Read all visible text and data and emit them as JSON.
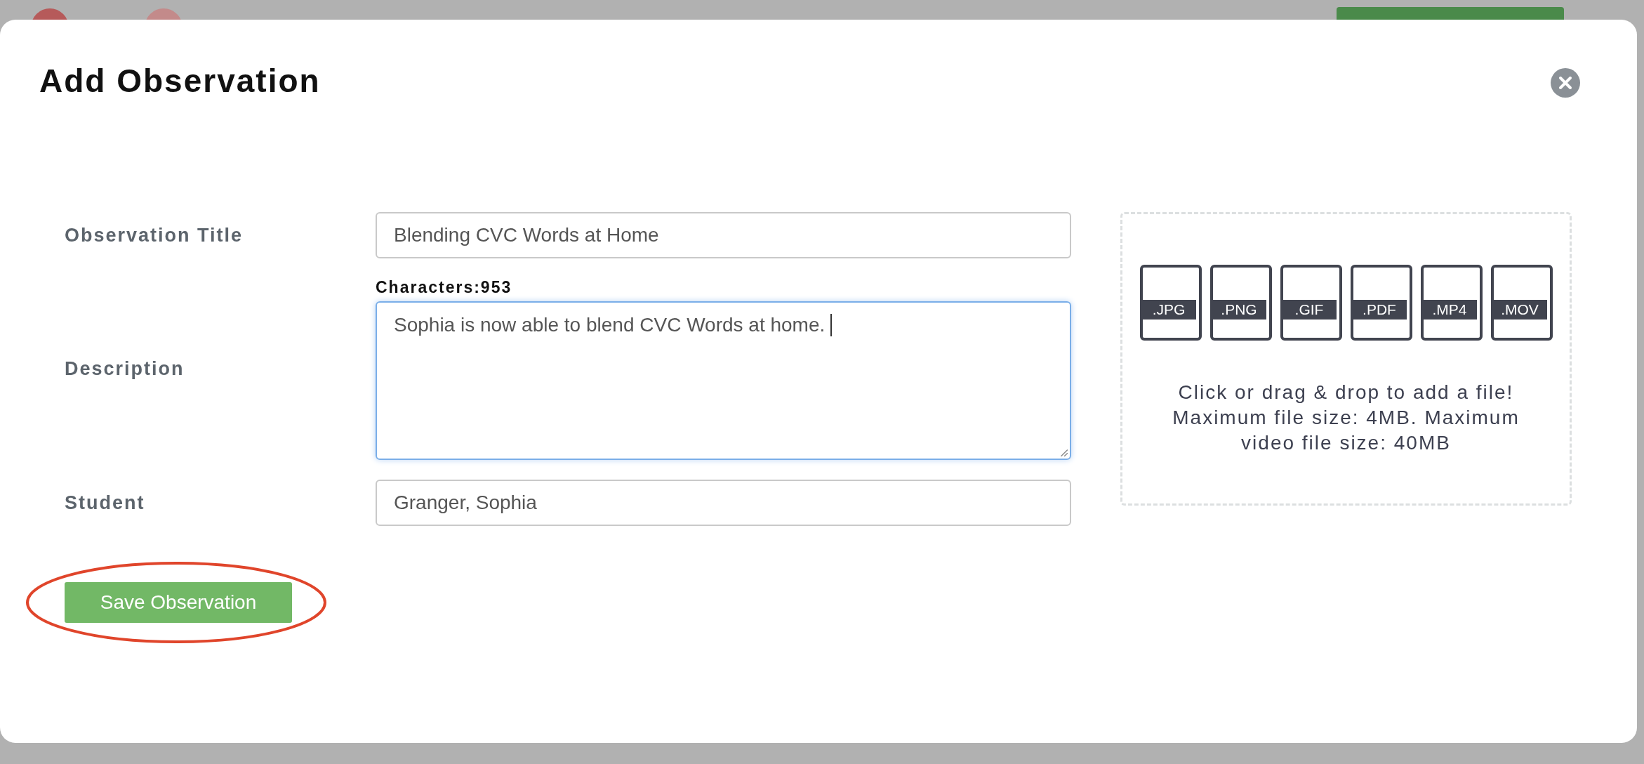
{
  "dialog": {
    "title": "Add Observation"
  },
  "fields": [
    {
      "kind": "input",
      "label": "Observation Title",
      "value": "Blending CVC Words at Home",
      "focused": false
    },
    {
      "kind": "textarea",
      "label": "Description",
      "counter": "Characters:953",
      "value": "Sophia is now able to blend CVC Words at home.",
      "focused": true
    },
    {
      "kind": "input",
      "label": "Student",
      "value": "Granger, Sophia",
      "focused": false
    }
  ],
  "save_button": {
    "label": "Save Observation",
    "circled": true
  },
  "dropzone": {
    "file_types": [
      ".JPG",
      ".PNG",
      ".GIF",
      ".PDF",
      ".MP4",
      ".MOV"
    ],
    "message": "Click or drag & drop to add a file! Maximum file size: 4MB. Maximum video file size: 40MB"
  }
}
